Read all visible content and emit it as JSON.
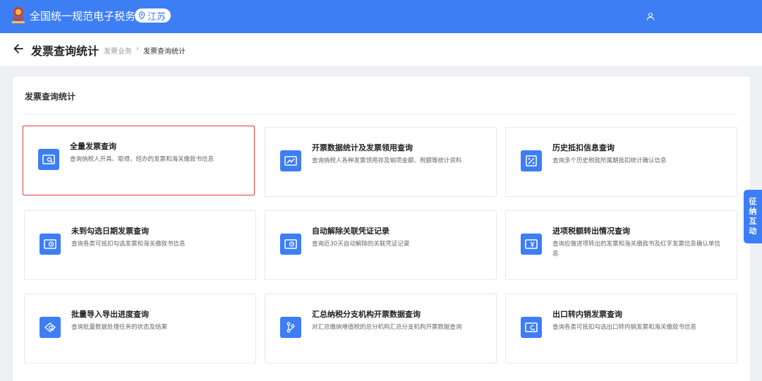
{
  "topbar": {
    "title": "全国统一规范电子税务局",
    "region": "江苏",
    "emblem_icon": "tax-emblem-icon",
    "user_icon": "user-icon",
    "bg_color": "#3d7ef5"
  },
  "header": {
    "back_icon": "back-arrow-icon",
    "title": "发票查询统计",
    "breadcrumb": [
      "发票业务",
      "发票查询统计"
    ],
    "breadcrumb_sep": "›"
  },
  "panel": {
    "title": "发票查询统计",
    "cards": [
      {
        "title": "全量发票查询",
        "desc": "查询纳税人开具、取得、经办的发票和海关缴款书信息",
        "icon": "invoice-search-icon",
        "selected": true
      },
      {
        "title": "开票数据统计及发票领用查询",
        "desc": "查询纳税人各种发票领用存及销项金额、税额等统计资料",
        "icon": "invoice-trend-icon",
        "selected": false
      },
      {
        "title": "历史抵扣信息查询",
        "desc": "查询多个历史税款所属期抵扣统计确认信息",
        "icon": "history-deduction-icon",
        "selected": false
      },
      {
        "title": "未到勾选日期发票查询",
        "desc": "查询各类可抵扣勾选发票和海关缴款书信息",
        "icon": "invoice-clock-icon",
        "selected": false
      },
      {
        "title": "自动解除关联凭证记录",
        "desc": "查询近30天自动解除的关联凭证记录",
        "icon": "invoice-clock-icon",
        "selected": false
      },
      {
        "title": "进项税额转出情况查询",
        "desc": "查询应做进项转出的发票和海关缴款书及红字发票信息确认单信息",
        "icon": "invoice-yen-icon",
        "selected": false
      },
      {
        "title": "批量导入导出进度查询",
        "desc": "查询批量数据处理任务的状态及结果",
        "icon": "batch-progress-icon",
        "selected": false
      },
      {
        "title": "汇总纳税分支机构开票数据查询",
        "desc": "对汇总缴纳增值税的总分机构汇总分支机构开票数据查询",
        "icon": "branch-icon",
        "selected": false
      },
      {
        "title": "出口转内销发票查询",
        "desc": "查询各类可抵扣勾选出口转内销发票和海关缴款书信息",
        "icon": "invoice-return-icon",
        "selected": false
      }
    ]
  },
  "float_tab": {
    "chars": [
      "征",
      "纳",
      "互",
      "动"
    ]
  }
}
